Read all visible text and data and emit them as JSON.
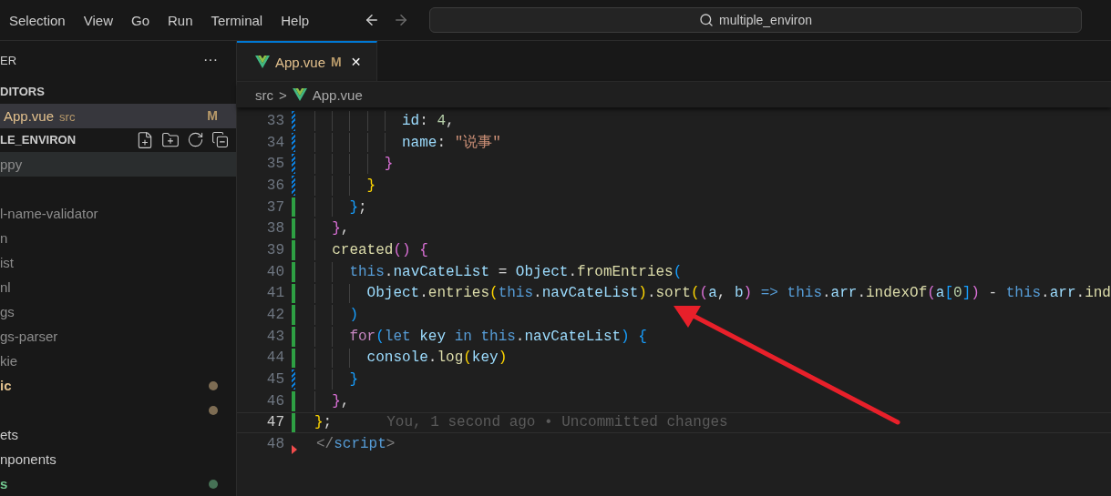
{
  "menu_bar": {
    "items": [
      "Selection",
      "View",
      "Go",
      "Run",
      "Terminal",
      "Help"
    ],
    "search": {
      "value": "multiple_environ"
    }
  },
  "sidebar": {
    "title": "ER",
    "more": "···",
    "open_editors": {
      "title": "DITORS",
      "items": [
        {
          "name": "App.vue",
          "folder": "src",
          "badge": "M",
          "selected": true
        }
      ]
    },
    "project": {
      "title": "LE_ENVIRON",
      "items": [
        {
          "label": "ppy",
          "color": "#8c8c8c",
          "dot": false,
          "hovered": true
        },
        {
          "dot": false,
          "hovered": false
        },
        {
          "label": "l-name-validator",
          "color": "#8c8c8c",
          "dot": false,
          "hovered": false
        },
        {
          "label": "n",
          "color": "#8c8c8c",
          "dot": false,
          "hovered": false
        },
        {
          "label": "ist",
          "color": "#8c8c8c",
          "dot": false,
          "hovered": false
        },
        {
          "label": "nl",
          "color": "#8c8c8c",
          "dot": false,
          "hovered": false
        },
        {
          "label": "gs",
          "color": "#8c8c8c",
          "dot": false,
          "hovered": false
        },
        {
          "label": "gs-parser",
          "color": "#8c8c8c",
          "dot": false,
          "hovered": false
        },
        {
          "label": "kie",
          "color": "#8c8c8c",
          "dot": false,
          "hovered": false
        },
        {
          "label": "ic",
          "color": "#e2c08d",
          "dot": true,
          "hovered": false
        },
        {
          "dot": true,
          "hovered": false
        },
        {
          "label": "ets",
          "color": "#cccccc",
          "dot": false,
          "hovered": false
        },
        {
          "label": "nponents",
          "color": "#cccccc",
          "dot": false,
          "hovered": false
        },
        {
          "label": "s",
          "color": "#73c991",
          "dot": true,
          "hovered": false
        }
      ]
    }
  },
  "tabs": [
    {
      "label": "App.vue",
      "badge": "M",
      "close": "✕",
      "selected": true
    }
  ],
  "breadcrumb": {
    "folder": "src",
    "separator": ">",
    "file": "App.vue"
  },
  "editor": {
    "lines": [
      {
        "number": "33",
        "kind": "modified",
        "current": false,
        "tokens": [
          {
            "t": "          id",
            "kind": "prop"
          },
          {
            "t": ": ",
            "kind": "punct"
          },
          {
            "t": "4",
            "kind": "number"
          },
          {
            "t": ",",
            "kind": "punct"
          }
        ]
      },
      {
        "number": "34",
        "kind": "modified",
        "current": false,
        "tokens": [
          {
            "t": "          name",
            "kind": "prop"
          },
          {
            "t": ": ",
            "kind": "punct"
          },
          {
            "t": "\"说事\"",
            "kind": "string"
          }
        ]
      },
      {
        "number": "35",
        "kind": "modified",
        "current": false,
        "tokens": [
          {
            "t": "        }",
            "kind": "b2"
          }
        ]
      },
      {
        "number": "36",
        "kind": "modified",
        "current": false,
        "tokens": [
          {
            "t": "      }",
            "kind": "b1"
          }
        ]
      },
      {
        "number": "37",
        "kind": "added",
        "current": false,
        "tokens": [
          {
            "t": "    }",
            "kind": "b3"
          },
          {
            "t": ";",
            "kind": "punct"
          }
        ]
      },
      {
        "number": "38",
        "kind": "added",
        "current": false,
        "tokens": [
          {
            "t": "  }",
            "kind": "b2"
          },
          {
            "t": ",",
            "kind": "punct"
          }
        ]
      },
      {
        "number": "39",
        "kind": "added",
        "current": false,
        "tokens": [
          {
            "t": "  created",
            "kind": "func"
          },
          {
            "t": "() {",
            "kind": "b2"
          }
        ]
      },
      {
        "number": "40",
        "kind": "added",
        "current": false,
        "tokens": [
          {
            "t": "    this",
            "kind": "kw"
          },
          {
            "t": ".",
            "kind": "punct"
          },
          {
            "t": "navCateList",
            "kind": "prop"
          },
          {
            "t": " = ",
            "kind": "punct"
          },
          {
            "t": "Object",
            "kind": "prop"
          },
          {
            "t": ".",
            "kind": "punct"
          },
          {
            "t": "fromEntries",
            "kind": "func"
          },
          {
            "t": "(",
            "kind": "b3"
          }
        ]
      },
      {
        "number": "41",
        "kind": "added",
        "current": false,
        "tokens": [
          {
            "t": "      Object",
            "kind": "prop"
          },
          {
            "t": ".",
            "kind": "punct"
          },
          {
            "t": "entries",
            "kind": "func"
          },
          {
            "t": "(",
            "kind": "b1"
          },
          {
            "t": "this",
            "kind": "kw"
          },
          {
            "t": ".",
            "kind": "punct"
          },
          {
            "t": "navCateList",
            "kind": "prop"
          },
          {
            "t": ")",
            "kind": "b1"
          },
          {
            "t": ".",
            "kind": "punct"
          },
          {
            "t": "sort",
            "kind": "func"
          },
          {
            "t": "(",
            "kind": "b1"
          },
          {
            "t": "(",
            "kind": "b2"
          },
          {
            "t": "a",
            "kind": "prop"
          },
          {
            "t": ", ",
            "kind": "punct"
          },
          {
            "t": "b",
            "kind": "prop"
          },
          {
            "t": ") ",
            "kind": "b2"
          },
          {
            "t": "=> this",
            "kind": "kw"
          },
          {
            "t": ".",
            "kind": "punct"
          },
          {
            "t": "arr",
            "kind": "prop"
          },
          {
            "t": ".",
            "kind": "punct"
          },
          {
            "t": "indexOf",
            "kind": "func"
          },
          {
            "t": "(",
            "kind": "b2"
          },
          {
            "t": "a",
            "kind": "prop"
          },
          {
            "t": "[",
            "kind": "b3"
          },
          {
            "t": "0",
            "kind": "number"
          },
          {
            "t": "]",
            "kind": "b3"
          },
          {
            "t": ")",
            "kind": "b2"
          },
          {
            "t": " - ",
            "kind": "punct"
          },
          {
            "t": "this",
            "kind": "kw"
          },
          {
            "t": ".",
            "kind": "punct"
          },
          {
            "t": "arr",
            "kind": "prop"
          },
          {
            "t": ".",
            "kind": "punct"
          },
          {
            "t": "ind",
            "kind": "func"
          }
        ]
      },
      {
        "number": "42",
        "kind": "added",
        "current": false,
        "tokens": [
          {
            "t": "    )",
            "kind": "b3"
          }
        ]
      },
      {
        "number": "43",
        "kind": "added",
        "current": false,
        "tokens": [
          {
            "t": "    for",
            "kind": "ctrl"
          },
          {
            "t": "(",
            "kind": "b3"
          },
          {
            "t": "let ",
            "kind": "kw"
          },
          {
            "t": "key ",
            "kind": "prop"
          },
          {
            "t": "in this",
            "kind": "kw"
          },
          {
            "t": ".",
            "kind": "punct"
          },
          {
            "t": "navCateList",
            "kind": "prop"
          },
          {
            "t": ") {",
            "kind": "b3"
          }
        ]
      },
      {
        "number": "44",
        "kind": "added",
        "current": false,
        "tokens": [
          {
            "t": "      console",
            "kind": "prop"
          },
          {
            "t": ".",
            "kind": "punct"
          },
          {
            "t": "log",
            "kind": "func"
          },
          {
            "t": "(",
            "kind": "b1"
          },
          {
            "t": "key",
            "kind": "prop"
          },
          {
            "t": ")",
            "kind": "b1"
          }
        ]
      },
      {
        "number": "45",
        "kind": "modified",
        "current": false,
        "tokens": [
          {
            "t": "    }",
            "kind": "b3"
          }
        ]
      },
      {
        "number": "46",
        "kind": "added",
        "current": false,
        "tokens": [
          {
            "t": "  }",
            "kind": "b2"
          },
          {
            "t": ",",
            "kind": "punct"
          }
        ]
      },
      {
        "number": "47",
        "kind": "added",
        "current": true,
        "blame": "You, 1 second ago • Uncommitted changes",
        "tokens": [
          {
            "t": "}",
            "kind": "b1"
          },
          {
            "t": ";",
            "kind": "punct"
          }
        ]
      },
      {
        "number": "48",
        "kind": "deleted",
        "current": false,
        "tokens": [
          {
            "t": "</",
            "kind": "tag"
          },
          {
            "t": "script",
            "kind": "tagname"
          },
          {
            "t": ">",
            "kind": "tag"
          }
        ]
      }
    ]
  }
}
